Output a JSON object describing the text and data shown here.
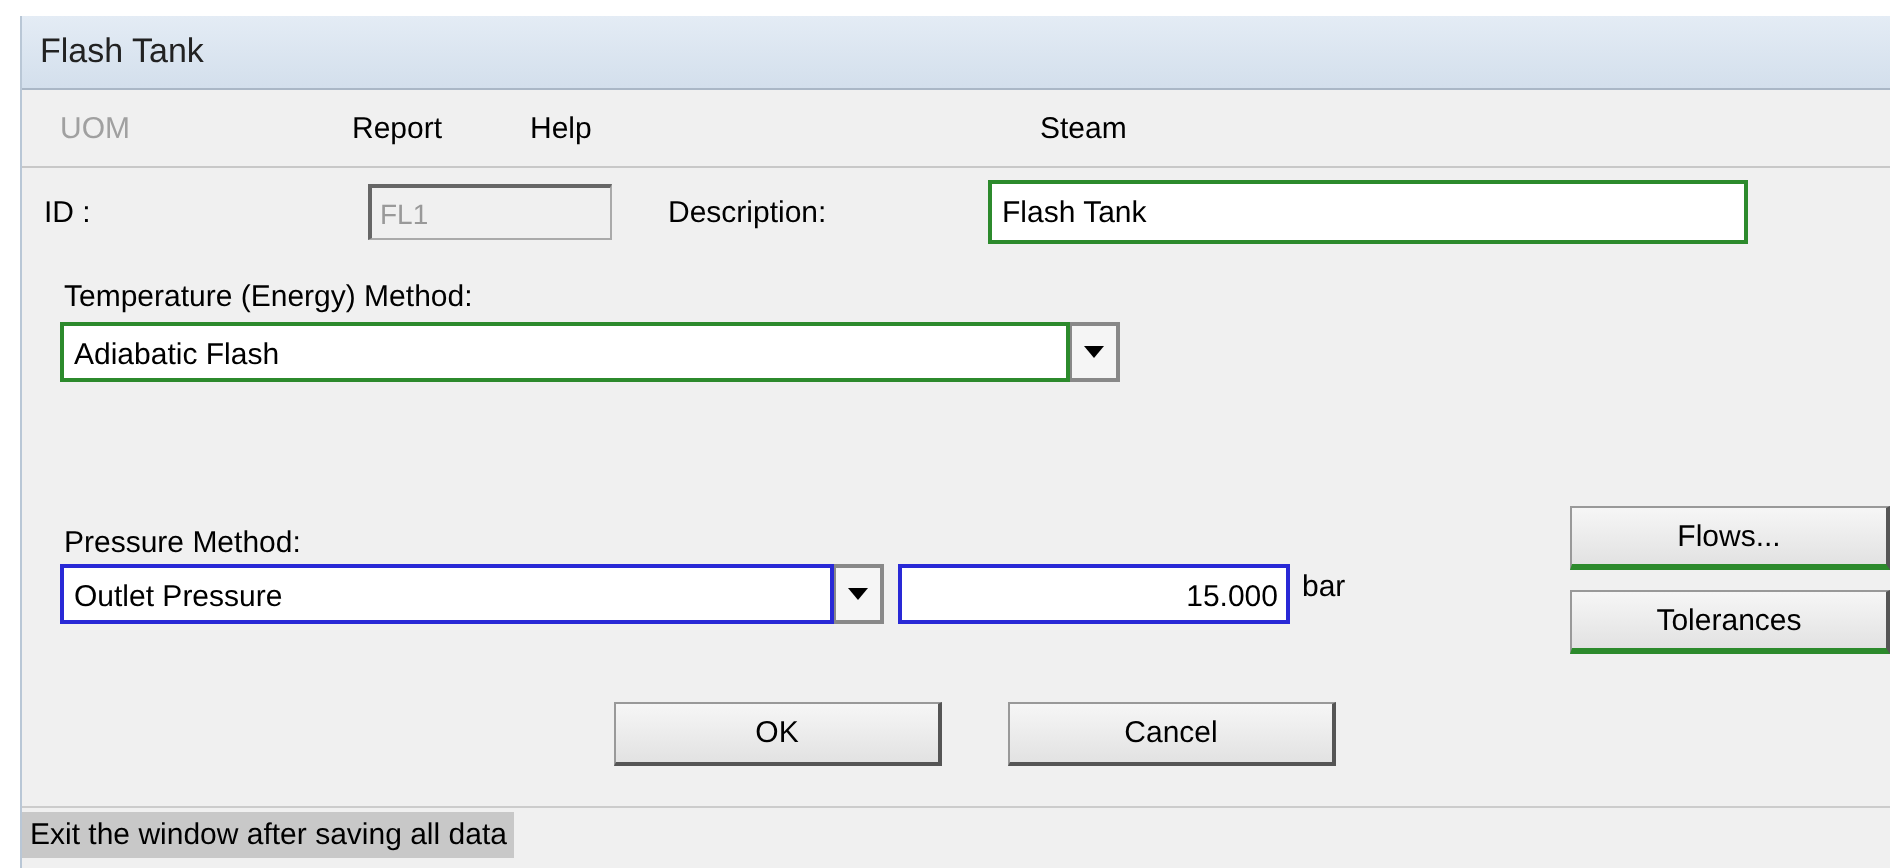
{
  "window": {
    "title": "Flash Tank"
  },
  "menu": [
    {
      "label": "UOM",
      "disabled": true
    },
    {
      "label": "Report",
      "disabled": false
    },
    {
      "label": "Help",
      "disabled": false
    },
    {
      "label": "Steam",
      "disabled": false
    }
  ],
  "id": {
    "label": "ID :",
    "value": "FL1",
    "disabled": true
  },
  "description": {
    "label": "Description:",
    "value": "Flash Tank"
  },
  "temperature_method": {
    "label": "Temperature (Energy) Method:",
    "value": "Adiabatic Flash"
  },
  "pressure_method": {
    "label": "Pressure Method:",
    "value": "Outlet Pressure"
  },
  "pressure": {
    "value": "15.000",
    "unit": "bar"
  },
  "side_buttons": [
    "Flows...",
    "Tolerances"
  ],
  "buttons": [
    "OK",
    "Cancel"
  ],
  "status_bar": "Exit the window after saving all data"
}
